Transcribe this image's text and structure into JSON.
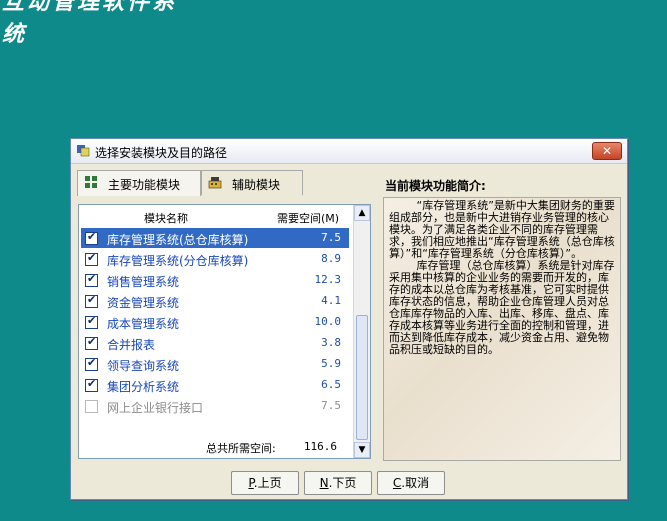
{
  "banner": {
    "text": "互动管理软件系统"
  },
  "dialog": {
    "title": "选择安装模块及目的路径",
    "close_label": "✕"
  },
  "tabs": [
    {
      "label": "主要功能模块",
      "icon": "grid-icon",
      "active": true
    },
    {
      "label": "辅助模块",
      "icon": "cash-register-icon",
      "active": false
    }
  ],
  "list": {
    "col_name": "模块名称",
    "col_space": "需要空间(M)",
    "rows": [
      {
        "name": "库存管理系统(总仓库核算)",
        "value": "7.5",
        "checked": true,
        "selected": true,
        "disabled": false
      },
      {
        "name": "库存管理系统(分仓库核算)",
        "value": "8.9",
        "checked": true,
        "selected": false,
        "disabled": false
      },
      {
        "name": "销售管理系统",
        "value": "12.3",
        "checked": true,
        "selected": false,
        "disabled": false
      },
      {
        "name": "资金管理系统",
        "value": "4.1",
        "checked": true,
        "selected": false,
        "disabled": false
      },
      {
        "name": "成本管理系统",
        "value": "10.0",
        "checked": true,
        "selected": false,
        "disabled": false
      },
      {
        "name": "合并报表",
        "value": "3.8",
        "checked": true,
        "selected": false,
        "disabled": false
      },
      {
        "name": "领导查询系统",
        "value": "5.9",
        "checked": true,
        "selected": false,
        "disabled": false
      },
      {
        "name": "集团分析系统",
        "value": "6.5",
        "checked": true,
        "selected": false,
        "disabled": false
      },
      {
        "name": "网上企业银行接口",
        "value": "7.5",
        "checked": false,
        "selected": false,
        "disabled": true
      }
    ],
    "total_label": "总共所需空间:",
    "total_value": "116.6"
  },
  "description": {
    "title": "当前模块功能简介:",
    "paragraphs": [
      "“库存管理系统”是新中大集团财务的重要组成部分，也是新中大进销存业务管理的核心模块。为了满足各类企业不同的库存管理需求，我们相应地推出“库存管理系统（总仓库核算）”和“库存管理系统（分仓库核算）”。",
      "库存管理（总仓库核算）系统是针对库存采用集中核算的企业业务的需要而开发的，库存的成本以总仓库为考核基准，它可实时提供库存状态的信息，帮助企业仓库管理人员对总仓库库存物品的入库、出库、移库、盘点、库存成本核算等业务进行全面的控制和管理，进而达到降低库存成本，减少资金占用、避免物品积压或短缺的目的。"
    ]
  },
  "buttons": {
    "prev_key": "P",
    "prev_label": ".上页",
    "next_key": "N",
    "next_label": ".下页",
    "cancel_key": "C",
    "cancel_label": ".取消"
  },
  "colors": {
    "desktop": "#0f8a8a",
    "selection": "#316ac5",
    "item_text": "#1947b8"
  }
}
